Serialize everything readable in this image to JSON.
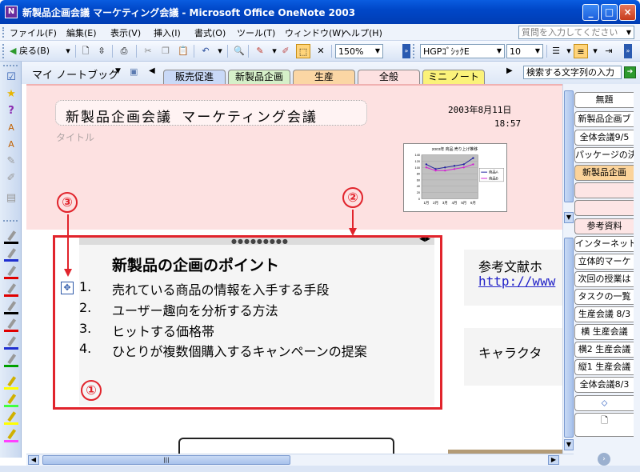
{
  "window": {
    "title": "新製品企画会議 マーケティング会議 - Microsoft Office OneNote 2003",
    "icon": "onenote-app-icon",
    "buttons": {
      "minimize": "_",
      "maximize": "□",
      "close": "×"
    }
  },
  "menubar": {
    "items": [
      "ファイル(F)",
      "編集(E)",
      "表示(V)",
      "挿入(I)",
      "書式(O)",
      "ツール(T)",
      "ウィンドウ(W)",
      "ヘルプ(H)"
    ],
    "help_placeholder": "質問を入力してください"
  },
  "toolbar": {
    "back_label": "戻る(B)",
    "zoom_value": "150%",
    "font_name": "HGPｺﾞｼｯｸE",
    "font_size": "10"
  },
  "notebook": {
    "name": "マイ ノートブック",
    "sections": [
      {
        "label": "販売促進",
        "color": "#c9d9f7"
      },
      {
        "label": "新製品企画",
        "color": "#d6f0c9"
      },
      {
        "label": "生産",
        "color": "#fbd6a4"
      },
      {
        "label": "全般",
        "color": "#fde1e1"
      },
      {
        "label": "ミニ ノート",
        "color": "#fbf27a"
      }
    ],
    "search_label": "検索する文字列の入力"
  },
  "page": {
    "title": "新製品企画会議 マーケティング会議",
    "title_hint": "タイトル",
    "date": "2003年8月11日",
    "time": "18:57",
    "outline": {
      "heading": "新製品の企画のポイント",
      "items": [
        {
          "num": "1.",
          "text": "売れている商品の情報を入手する手段"
        },
        {
          "num": "2.",
          "text": "ユーザー趣向を分析する方法"
        },
        {
          "num": "3.",
          "text": "ヒットする価格帯"
        },
        {
          "num": "4.",
          "text": "ひとりが複数個購入するキャンペーンの提案"
        }
      ]
    },
    "reference_title": "参考文献ホ",
    "reference_link": "http://www",
    "character_text": "キャラクタ"
  },
  "callouts": {
    "one": "①",
    "two": "②",
    "three": "③"
  },
  "page_tabs": [
    {
      "label": "無題",
      "kind": "normal"
    },
    {
      "label": "新製品企画ブ",
      "kind": "normal"
    },
    {
      "label": "全体会議9/5",
      "kind": "normal"
    },
    {
      "label": "パッケージの決",
      "kind": "normal"
    },
    {
      "label": "新製品企画",
      "kind": "sel"
    },
    {
      "label": "",
      "kind": "blank"
    },
    {
      "label": "",
      "kind": "blank"
    },
    {
      "label": "参考資料",
      "kind": "grp"
    },
    {
      "label": "インターネット",
      "kind": "normal"
    },
    {
      "label": "立体的マーケ",
      "kind": "normal"
    },
    {
      "label": "次回の授業は",
      "kind": "normal"
    },
    {
      "label": "タスクの一覧",
      "kind": "normal"
    },
    {
      "label": "生産会議 8/3",
      "kind": "normal"
    },
    {
      "label": "横 生産会議",
      "kind": "normal"
    },
    {
      "label": "横2 生産会議",
      "kind": "normal"
    },
    {
      "label": "縦1 生産会議",
      "kind": "normal"
    },
    {
      "label": "全体会議8/3",
      "kind": "normal"
    }
  ],
  "chart_data": {
    "type": "line",
    "title": "2003年 商品 売り上げ推移",
    "categories": [
      "1月",
      "2月",
      "3月",
      "4月",
      "5月",
      "6月"
    ],
    "ylim": [
      0,
      140
    ],
    "yticks": [
      "140",
      "120",
      "100",
      "80",
      "60",
      "40",
      "20",
      "0"
    ],
    "series": [
      {
        "name": "商品A",
        "values": [
          110,
          95,
          100,
          105,
          110,
          130
        ],
        "color": "#1f1fa0"
      },
      {
        "name": "商品B",
        "values": [
          100,
          90,
          90,
          95,
          100,
          110
        ],
        "color": "#d21fd2"
      }
    ]
  },
  "colors": {
    "accent_red": "#e1242c",
    "header_pink": "#fde1e1"
  }
}
